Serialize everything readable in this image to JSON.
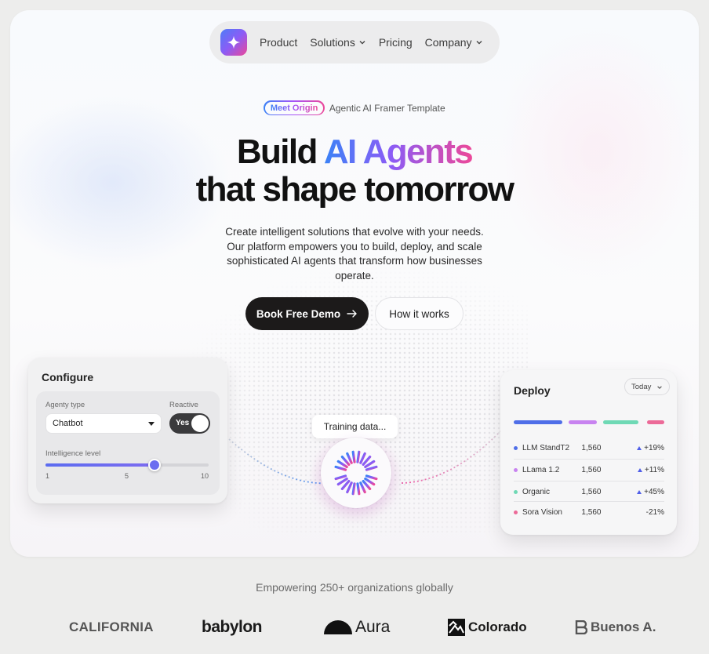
{
  "nav": {
    "items": [
      {
        "label": "Product",
        "has_dropdown": false
      },
      {
        "label": "Solutions",
        "has_dropdown": true
      },
      {
        "label": "Pricing",
        "has_dropdown": false
      },
      {
        "label": "Company",
        "has_dropdown": true
      }
    ]
  },
  "badge": {
    "pill": "Meet Origin",
    "text": "Agentic AI Framer Template"
  },
  "headline": {
    "part1": "Build ",
    "highlight": "AI Agents",
    "line2": "that shape tomorrow"
  },
  "subtitle": "Create intelligent solutions that evolve with your needs. Our platform empowers you to build, deploy, and scale sophisticated AI agents that transform how businesses operate.",
  "cta": {
    "primary": "Book Free Demo",
    "secondary": "How it works"
  },
  "configure": {
    "title": "Configure",
    "agent_type_label": "Agenty type",
    "agent_type_value": "Chatbot",
    "reactive_label": "Reactive",
    "toggle_value": "Yes",
    "intelligence_label": "Intelligence level",
    "slider": {
      "min": 1,
      "mid": 5,
      "max": 10,
      "value": 7
    },
    "ticks": [
      "1",
      "5",
      "10"
    ]
  },
  "training": {
    "label": "Training data..."
  },
  "deploy": {
    "title": "Deploy",
    "filter": "Today",
    "bar_colors": [
      "#4f6ee8",
      "#c883f0",
      "#6fd9b5",
      "#ec6a98"
    ],
    "rows": [
      {
        "name": "LLM StandT2",
        "value": "1,560",
        "change": "+19%",
        "up": true,
        "color": "#4f6ee8"
      },
      {
        "name": "LLama 1.2",
        "value": "1,560",
        "change": "+11%",
        "up": true,
        "color": "#c883f0"
      },
      {
        "name": "Organic",
        "value": "1,560",
        "change": "+45%",
        "up": true,
        "color": "#6fd9b5"
      },
      {
        "name": "Sora Vision",
        "value": "1,560",
        "change": "-21%",
        "up": false,
        "color": "#ec6a98"
      }
    ]
  },
  "tagline": "Empowering 250+ organizations globally",
  "logos": [
    "CALIFORNIA",
    "babylon",
    "Aura",
    "Colorado",
    "Buenos A."
  ]
}
